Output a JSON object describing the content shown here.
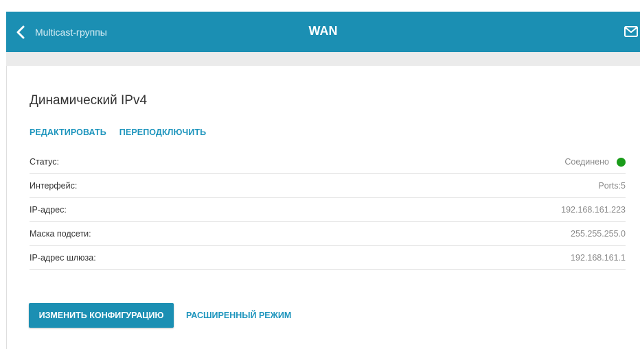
{
  "header": {
    "back_label": "Multicast-группы",
    "title": "WAN",
    "back_icon": "chevron-left-icon",
    "mail_icon": "mail-icon",
    "color": "#1b8fb3"
  },
  "connection": {
    "title": "Динамический IPv4",
    "actions": {
      "edit_label": "РЕДАКТИРОВАТЬ",
      "reconnect_label": "ПЕРЕПОДКЛЮЧИТЬ"
    },
    "rows": [
      {
        "label": "Статус:",
        "value": "Соединено"
      },
      {
        "label": "Интерфейс:",
        "value": "Ports:5"
      },
      {
        "label": "IP-адрес:",
        "value": "192.168.161.223"
      },
      {
        "label": "Маска подсети:",
        "value": "255.255.255.0"
      },
      {
        "label": "IP-адрес шлюза:",
        "value": "192.168.161.1"
      }
    ],
    "status_color": "#1a9c1a"
  },
  "footer": {
    "change_config_label": "ИЗМЕНИТЬ КОНФИГУРАЦИЮ",
    "advanced_mode_label": "РАСШИРЕННЫЙ РЕЖИМ"
  }
}
